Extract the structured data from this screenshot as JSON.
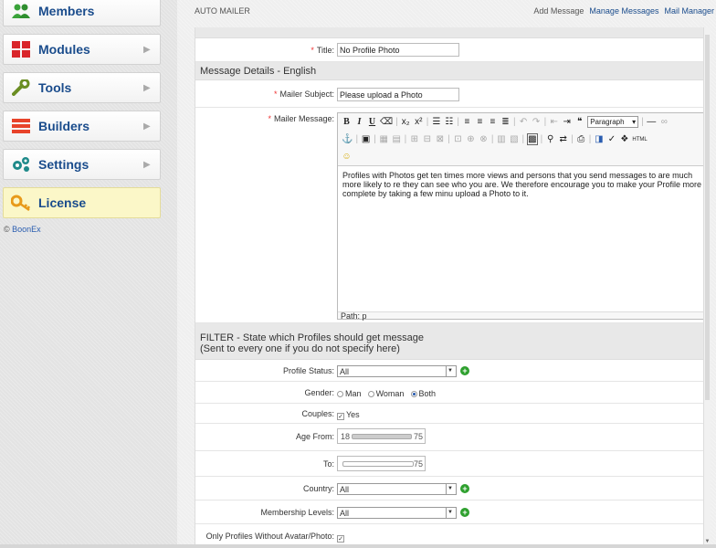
{
  "sidebar": {
    "items": [
      {
        "label": "Members",
        "icon": "members-icon",
        "has_arrow": false
      },
      {
        "label": "Modules",
        "icon": "modules-icon",
        "has_arrow": true
      },
      {
        "label": "Tools",
        "icon": "wrench-icon",
        "has_arrow": true
      },
      {
        "label": "Builders",
        "icon": "builders-icon",
        "has_arrow": true
      },
      {
        "label": "Settings",
        "icon": "gears-icon",
        "has_arrow": true
      },
      {
        "label": "License",
        "icon": "key-icon",
        "has_arrow": false
      }
    ],
    "copyright_symbol": "©",
    "copyright_link": "BoonEx"
  },
  "header": {
    "title": "AUTO MAILER",
    "links": [
      "Add Message",
      "Manage Messages",
      "Mail Manager"
    ]
  },
  "form": {
    "title_label": "Title:",
    "title_value": "No Profile Photo",
    "details_header": "Message Details - English",
    "subject_label": "Mailer Subject:",
    "subject_value": "Please upload a Photo",
    "message_label": "Mailer Message:",
    "editor": {
      "format_value": "Paragraph",
      "body": "Profiles with Photos get ten times more views and persons that you send messages to are much more likely to re they can see who you are. We therefore encourage you to make your Profile more complete by taking a few minu upload a Photo to it.",
      "path": "Path: p"
    },
    "filter_header_line1": "FILTER - State which Profiles should get message",
    "filter_header_line2": "(Sent to every one if you do not specify here)",
    "profile_status_label": "Profile Status:",
    "profile_status_value": "All",
    "gender_label": "Gender:",
    "gender_options": [
      "Man",
      "Woman",
      "Both"
    ],
    "gender_selected": "Both",
    "couples_label": "Couples:",
    "couples_value": "Yes",
    "age_from_label": "Age From:",
    "age_from_min": "18",
    "age_from_max": "75",
    "to_label": "To:",
    "to_max": "75",
    "country_label": "Country:",
    "country_value": "All",
    "membership_label": "Membership Levels:",
    "membership_value": "All",
    "no_avatar_label": "Only Profiles Without Avatar/Photo:"
  },
  "colors": {
    "link": "#1a4c8c",
    "required": "#ee3333",
    "add": "#2ea02e"
  }
}
